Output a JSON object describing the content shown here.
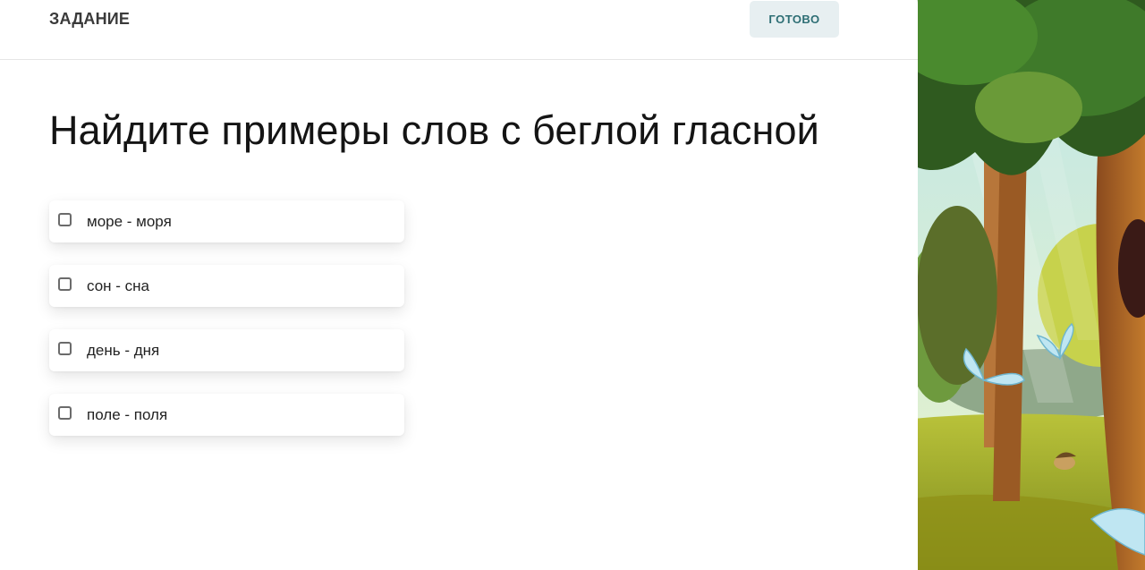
{
  "header": {
    "title": "ЗАДАНИЕ",
    "done_label": "ГОТОВО"
  },
  "task": {
    "question": "Найдите примеры слов с беглой гласной",
    "options": [
      {
        "label": "море - моря",
        "checked": false
      },
      {
        "label": "сон - сна",
        "checked": false
      },
      {
        "label": "день - дня",
        "checked": false
      },
      {
        "label": "поле - поля",
        "checked": false
      }
    ]
  },
  "colors": {
    "done_button_bg": "#e7eff1",
    "done_button_text": "#2d6e74",
    "panel_bg": "#ffffff"
  }
}
